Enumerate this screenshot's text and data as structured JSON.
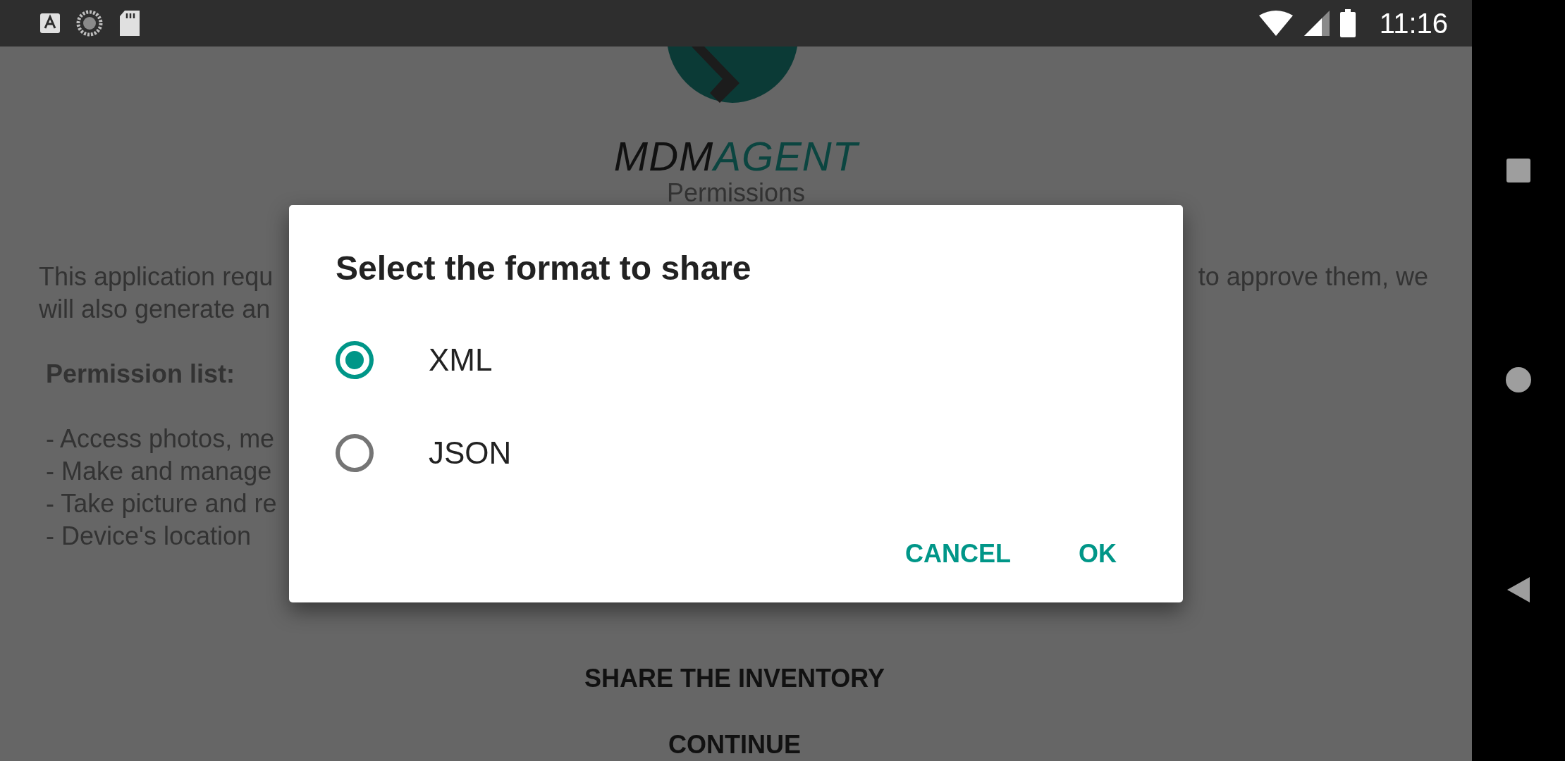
{
  "status_bar": {
    "time": "11:16"
  },
  "app": {
    "logo": {
      "dark_part": "MDM",
      "accent_part": "AGENT"
    },
    "heading": "Permissions",
    "intro_left": [
      "This application requ",
      "will also generate an"
    ],
    "intro_right": [
      "to approve them, we"
    ],
    "list_title": "Permission list:",
    "permissions": [
      "- Access photos, me",
      "- Make and manage",
      "- Take picture and re",
      "- Device's location"
    ],
    "buttons": [
      "SHARE THE INVENTORY",
      "CONTINUE"
    ]
  },
  "dialog": {
    "title": "Select the format to share",
    "options": [
      {
        "label": "XML",
        "selected": true
      },
      {
        "label": "JSON",
        "selected": false
      }
    ],
    "actions": [
      "CANCEL",
      "OK"
    ]
  }
}
